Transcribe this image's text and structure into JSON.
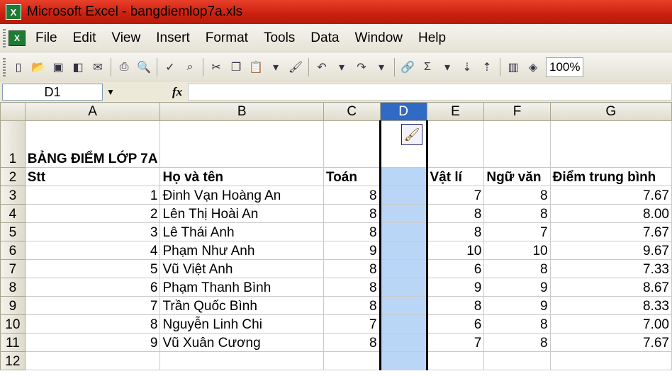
{
  "window": {
    "title": "Microsoft Excel - bangdiemlop7a.xls",
    "app_icon": "X"
  },
  "menu": [
    {
      "label": "File"
    },
    {
      "label": "Edit"
    },
    {
      "label": "View"
    },
    {
      "label": "Insert"
    },
    {
      "label": "Format"
    },
    {
      "label": "Tools"
    },
    {
      "label": "Data"
    },
    {
      "label": "Window"
    },
    {
      "label": "Help"
    }
  ],
  "toolbar": {
    "zoom": "100%"
  },
  "formula_bar": {
    "name_box": "D1",
    "fx": "fx",
    "formula": ""
  },
  "sheet": {
    "columns": [
      "A",
      "B",
      "C",
      "D",
      "E",
      "F",
      "G"
    ],
    "selected_column": "D",
    "rows": [
      {
        "num": "1",
        "cells": [
          "BẢNG ĐIỂM LỚP 7A",
          "",
          "",
          "",
          "",
          "",
          ""
        ]
      },
      {
        "num": "2",
        "cells": [
          "Stt",
          "Họ và tên",
          "Toán",
          "",
          "Vật lí",
          "Ngữ văn",
          "Điểm trung bình"
        ]
      },
      {
        "num": "3",
        "cells": [
          "1",
          "Đinh Vạn Hoàng An",
          "8",
          "",
          "7",
          "8",
          "7.67"
        ]
      },
      {
        "num": "4",
        "cells": [
          "2",
          "Lên Thị Hoài An",
          "8",
          "",
          "8",
          "8",
          "8.00"
        ]
      },
      {
        "num": "5",
        "cells": [
          "3",
          "Lê Thái Anh",
          "8",
          "",
          "8",
          "7",
          "7.67"
        ]
      },
      {
        "num": "6",
        "cells": [
          "4",
          "Phạm Như Anh",
          "9",
          "",
          "10",
          "10",
          "9.67"
        ]
      },
      {
        "num": "7",
        "cells": [
          "5",
          "Vũ Việt Anh",
          "8",
          "",
          "6",
          "8",
          "7.33"
        ]
      },
      {
        "num": "8",
        "cells": [
          "6",
          "Phạm Thanh Bình",
          "8",
          "",
          "9",
          "9",
          "8.67"
        ]
      },
      {
        "num": "9",
        "cells": [
          "7",
          "Trần Quốc Bình",
          "8",
          "",
          "8",
          "9",
          "8.33"
        ]
      },
      {
        "num": "10",
        "cells": [
          "8",
          "Nguyễn Linh Chi",
          "7",
          "",
          "6",
          "8",
          "7.00"
        ]
      },
      {
        "num": "11",
        "cells": [
          "9",
          "Vũ Xuân Cương",
          "8",
          "",
          "7",
          "8",
          "7.67"
        ]
      },
      {
        "num": "12",
        "cells": [
          "",
          "",
          "",
          "",
          "",
          "",
          ""
        ]
      }
    ]
  },
  "colors": {
    "title_bar": "#d42a14",
    "selection": "#b9d6f7",
    "header_selected": "#316ac5"
  }
}
